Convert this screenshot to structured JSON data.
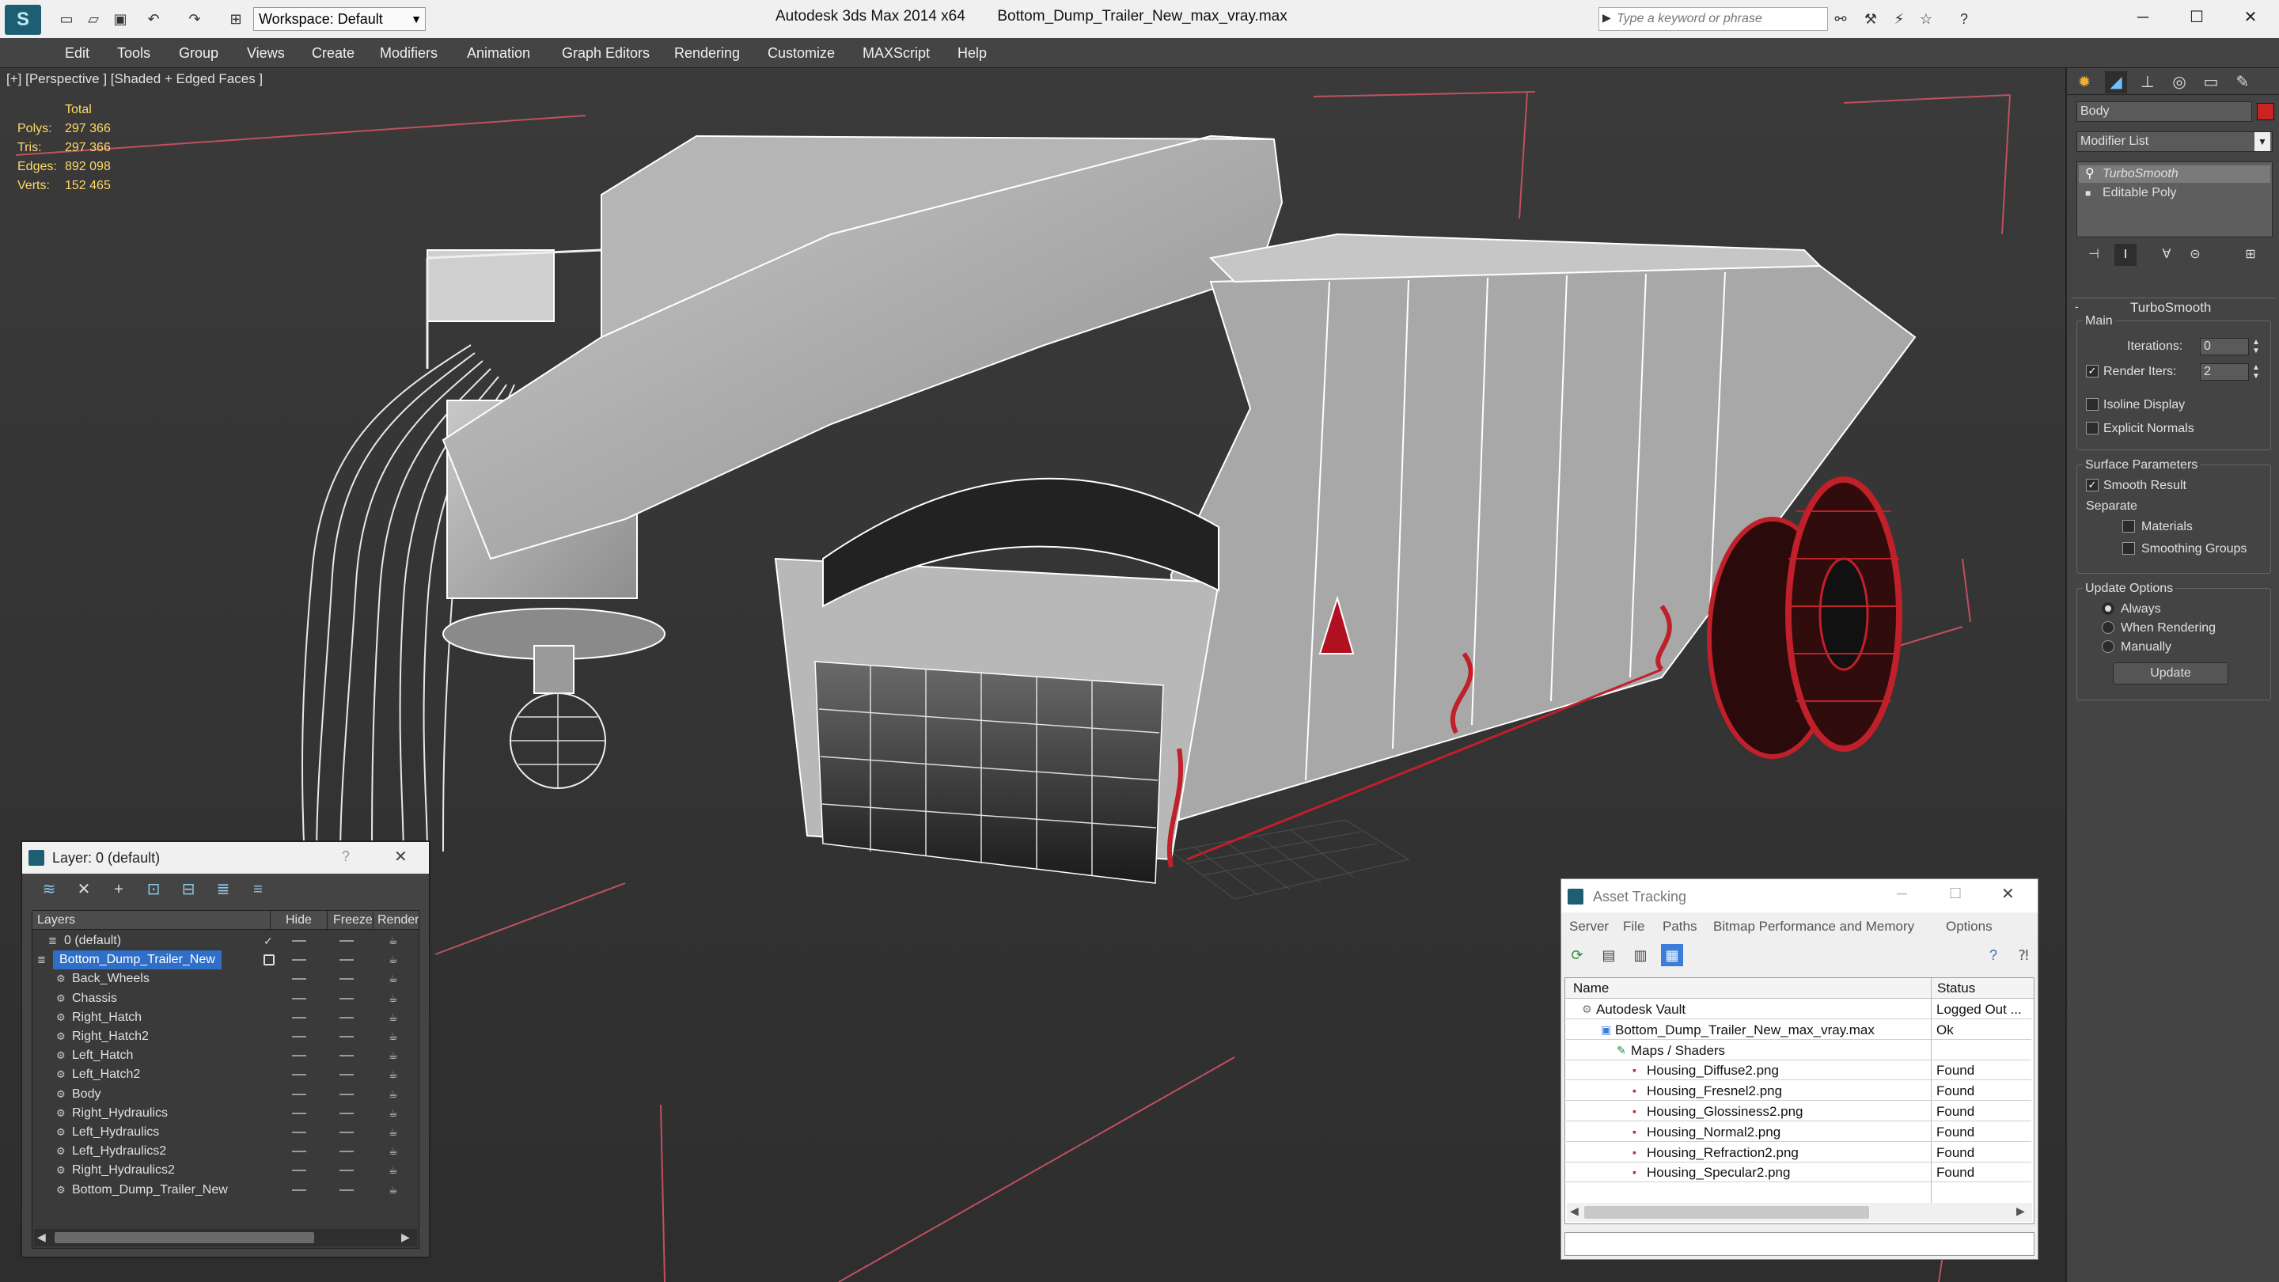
{
  "app": {
    "title": "Autodesk 3ds Max  2014 x64",
    "file": "Bottom_Dump_Trailer_New_max_vray.max",
    "workspace": "Workspace: Default",
    "search_placeholder": "Type a keyword or phrase"
  },
  "menu": [
    "Edit",
    "Tools",
    "Group",
    "Views",
    "Create",
    "Modifiers",
    "Animation",
    "Graph Editors",
    "Rendering",
    "Customize",
    "MAXScript",
    "Help"
  ],
  "viewport": {
    "label": "[+] [Perspective ] [Shaded + Edged Faces ]",
    "stats": {
      "header": "Total",
      "rows": [
        {
          "label": "Polys:",
          "value": "297 366"
        },
        {
          "label": "Tris:",
          "value": "297 366"
        },
        {
          "label": "Edges:",
          "value": "892 098"
        },
        {
          "label": "Verts:",
          "value": "152 465"
        }
      ]
    }
  },
  "command_panel": {
    "object_name": "Body",
    "modifier_list": "Modifier List",
    "stack": [
      "TurboSmooth",
      "Editable Poly"
    ],
    "rollout_title": "TurboSmooth",
    "main_group": "Main",
    "iterations_label": "Iterations:",
    "iterations_value": "0",
    "render_iters_label": "Render Iters:",
    "render_iters_value": "2",
    "isoline_label": "Isoline Display",
    "explicit_normals_label": "Explicit Normals",
    "surface_group": "Surface Parameters",
    "smooth_result_label": "Smooth Result",
    "separate_label": "Separate",
    "materials_label": "Materials",
    "smoothing_groups_label": "Smoothing Groups",
    "update_group": "Update Options",
    "always_label": "Always",
    "when_rendering_label": "When Rendering",
    "manually_label": "Manually",
    "update_button": "Update",
    "accent_color": "#cc2222"
  },
  "layer_panel": {
    "title": "Layer: 0 (default)",
    "help": "?",
    "columns": [
      "Layers",
      "Hide",
      "Freeze",
      "Render"
    ],
    "rows": [
      {
        "name": "0 (default)"
      },
      {
        "name": "Bottom_Dump_Trailer_New"
      },
      {
        "name": "Back_Wheels"
      },
      {
        "name": "Chassis"
      },
      {
        "name": "Right_Hatch"
      },
      {
        "name": "Right_Hatch2"
      },
      {
        "name": "Left_Hatch"
      },
      {
        "name": "Left_Hatch2"
      },
      {
        "name": "Body"
      },
      {
        "name": "Right_Hydraulics"
      },
      {
        "name": "Left_Hydraulics"
      },
      {
        "name": "Left_Hydraulics2"
      },
      {
        "name": "Right_Hydraulics2"
      },
      {
        "name": "Bottom_Dump_Trailer_New"
      }
    ]
  },
  "asset_panel": {
    "title": "Asset Tracking",
    "menu": [
      "Server",
      "File",
      "Paths",
      "Bitmap Performance and Memory",
      "Options"
    ],
    "columns": [
      "Name",
      "Status"
    ],
    "rows": [
      {
        "name": "Autodesk Vault",
        "status": "Logged Out ..."
      },
      {
        "name": "Bottom_Dump_Trailer_New_max_vray.max",
        "status": "Ok"
      },
      {
        "name": "Maps / Shaders",
        "status": ""
      },
      {
        "name": "Housing_Diffuse2.png",
        "status": "Found"
      },
      {
        "name": "Housing_Fresnel2.png",
        "status": "Found"
      },
      {
        "name": "Housing_Glossiness2.png",
        "status": "Found"
      },
      {
        "name": "Housing_Normal2.png",
        "status": "Found"
      },
      {
        "name": "Housing_Refraction2.png",
        "status": "Found"
      },
      {
        "name": "Housing_Specular2.png",
        "status": "Found"
      }
    ]
  }
}
